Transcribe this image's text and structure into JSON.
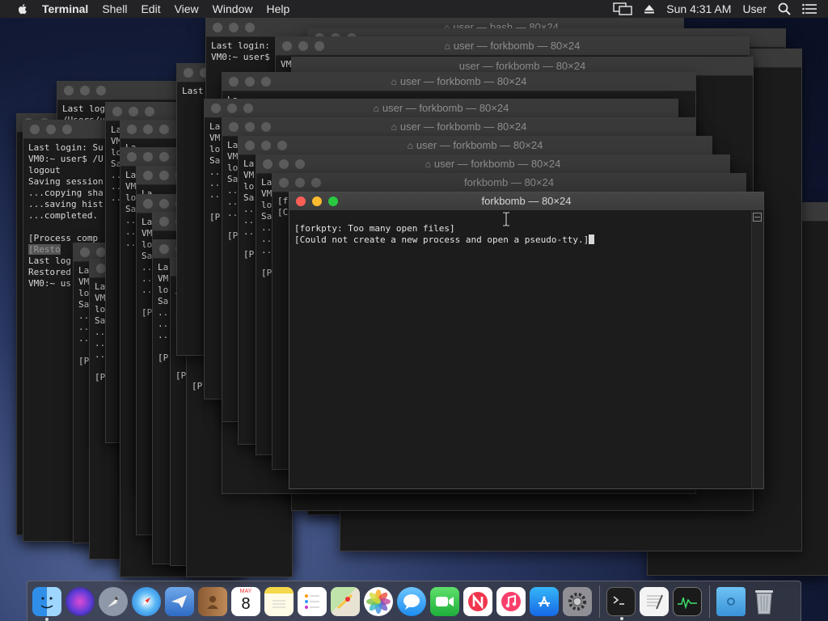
{
  "menubar": {
    "app_name": "Terminal",
    "items": [
      "Shell",
      "Edit",
      "View",
      "Window",
      "Help"
    ],
    "clock": "Sun 4:31 AM",
    "user": "User"
  },
  "front_window": {
    "title": "forkbomb — 80×24",
    "lines": [
      "[forkpty: Too many open files]",
      "[Could not create a new process and open a pseudo-tty.]"
    ]
  },
  "window_titles": {
    "user_forkbomb": "user — forkbomb — 80×24",
    "user_bash": "user — bash — 80×24",
    "forkbomb": "forkbomb — 80×24"
  },
  "bg_text": {
    "last_login": "Last login:",
    "last_login_su": "Last login: Su",
    "last_log": "Last log",
    "last_lo": "Last lo",
    "users_path": "/Users/u",
    "prompt_user": "VM0:~ user$",
    "prompt_user_path": "VM0:~ user$ /U",
    "prompt_us": "VM0:~ us",
    "logout": "logout",
    "saving_session": "Saving session",
    "copying": "...copying sha",
    "saving_hist": "...saving hist",
    "completed": "...completed.",
    "process_comp": "[Process comp",
    "restored": "[Resto",
    "restored2": "Restored",
    "la": "La",
    "vm": "VM",
    "lo": "lo",
    "sa": "Sa",
    "dots": "..",
    "p": "[P",
    "pr": "[P...",
    "f": "[f",
    "c": "[C"
  },
  "dock": {
    "calendar_month": "MAY",
    "calendar_day": "8"
  },
  "colors": {
    "menubar_bg": "#232325",
    "window_bg": "#1b1b1b",
    "titlebar_bg": "#3a3a3a",
    "traffic_red": "#fd5f57",
    "traffic_yellow": "#febb2e",
    "traffic_green": "#2ac940"
  }
}
